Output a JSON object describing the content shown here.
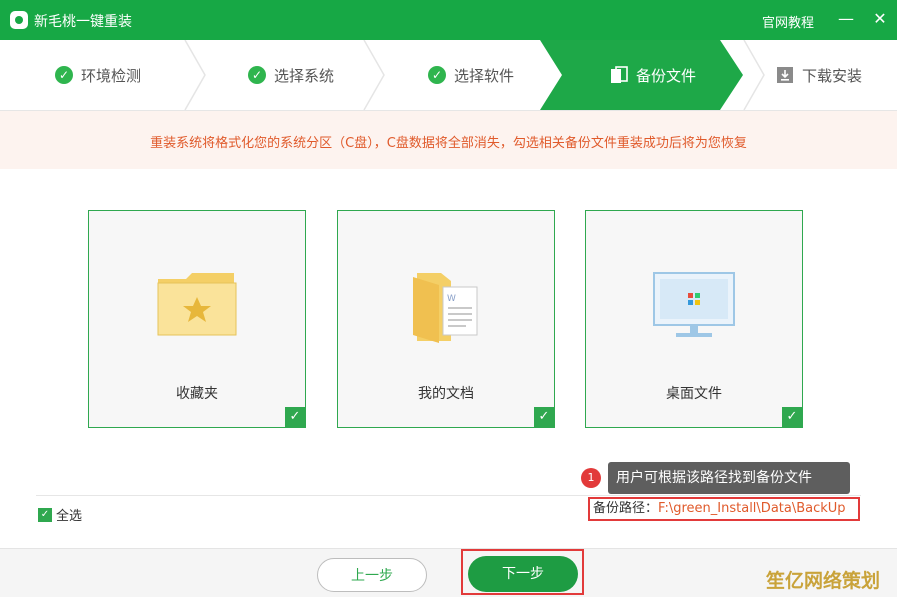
{
  "titlebar": {
    "app_title": "新毛桃一键重装",
    "tutorial_link": "官网教程",
    "minimize": "—",
    "close": "✕"
  },
  "steps": [
    {
      "label": "环境检测",
      "state": "done",
      "icon": "check-icon"
    },
    {
      "label": "选择系统",
      "state": "done",
      "icon": "check-icon"
    },
    {
      "label": "选择软件",
      "state": "done",
      "icon": "check-icon"
    },
    {
      "label": "备份文件",
      "state": "active",
      "icon": "backup-icon"
    },
    {
      "label": "下载安装",
      "state": "pending",
      "icon": "download-icon"
    }
  ],
  "banner": {
    "text": "重装系统将格式化您的系统分区（C盘），C盘数据将全部消失，勾选相关备份文件重装成功后将为您恢复"
  },
  "cards": [
    {
      "label": "收藏夹",
      "checked": true,
      "icon": "favorites-folder-icon"
    },
    {
      "label": "我的文档",
      "checked": true,
      "icon": "documents-icon"
    },
    {
      "label": "桌面文件",
      "checked": true,
      "icon": "desktop-monitor-icon"
    }
  ],
  "check_mark": "✓",
  "annotation": {
    "badge": "1",
    "tooltip": "用户可根据该路径找到备份文件"
  },
  "select_all": {
    "label": "全选",
    "checked": true
  },
  "backup_path": {
    "label": "备份路径：",
    "value": "F:\\green_Install\\Data\\BackUp"
  },
  "buttons": {
    "prev": "上一步",
    "next": "下一步"
  },
  "watermark": "笙亿网络策划",
  "colors": {
    "brand_green": "#17a845",
    "accent_orange": "#e05a2b",
    "highlight_red": "#e23a3a"
  }
}
